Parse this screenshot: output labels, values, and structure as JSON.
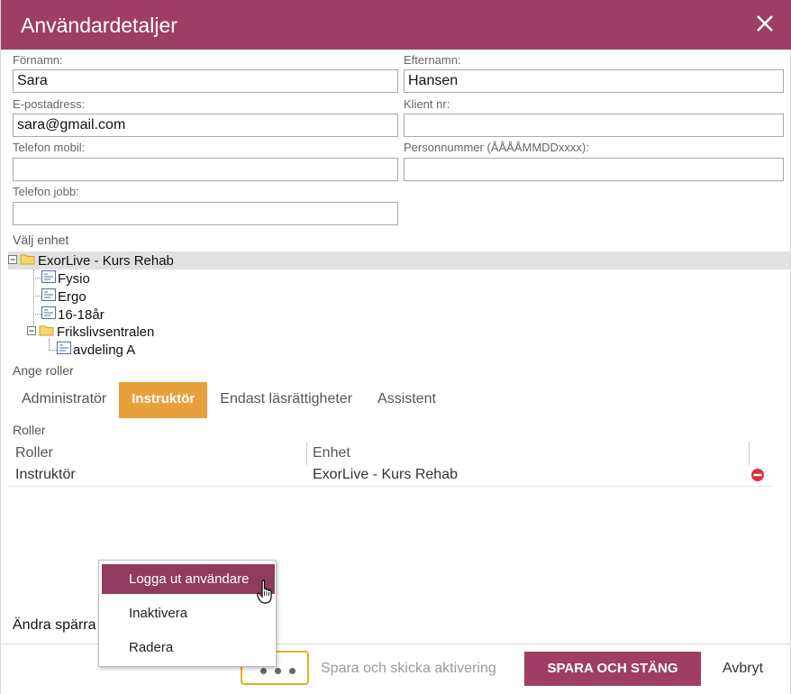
{
  "dialog": {
    "title": "Användardetaljer",
    "close_icon": "close-icon"
  },
  "form": {
    "firstname_label": "Förnamn:",
    "firstname_value": "Sara",
    "lastname_label": "Efternamn:",
    "lastname_value": "Hansen",
    "email_label": "E-postadress:",
    "email_value": "sara@gmail.com",
    "client_label": "Klient nr:",
    "client_value": "",
    "mobile_label": "Telefon mobil:",
    "mobile_value": "",
    "personal_label": "Personnummer (ÅÅÅÅMMDDxxxx):",
    "personal_value": "",
    "work_phone_label": "Telefon jobb:",
    "work_phone_value": ""
  },
  "unit": {
    "label": "Välj enhet",
    "root": "ExorLive - Kurs Rehab",
    "children": [
      "Fysio",
      "Ergo",
      "16-18år"
    ],
    "folder": "Frikslivsentralen",
    "folder_children": [
      "avdeling A"
    ]
  },
  "roles": {
    "label": "Ange roller",
    "tabs": [
      "Administratör",
      "Instruktör",
      "Endast läsrättigheter",
      "Assistent"
    ],
    "active_tab": "Instruktör",
    "grid_label": "Roller",
    "columns": [
      "Roller",
      "Enhet"
    ],
    "rows": [
      {
        "role": "Instruktör",
        "unit": "ExorLive - Kurs Rehab"
      }
    ]
  },
  "footer": {
    "andra_text": "Ändra spärra",
    "more_button": "more-options",
    "send_activation": "Spara och skicka aktivering",
    "save_close": "SPARA OCH STÄNG",
    "cancel": "Avbryt"
  },
  "menu": {
    "items": [
      "Logga ut användare",
      "Inaktivera",
      "Radera"
    ],
    "highlighted": "Logga ut användare"
  },
  "colors": {
    "brand": "#9e3e64",
    "active_tab": "#e8a03c",
    "menu_highlight": "#903b5e",
    "focus_ring": "#e8b01f",
    "delete_icon": "#e0303a"
  }
}
